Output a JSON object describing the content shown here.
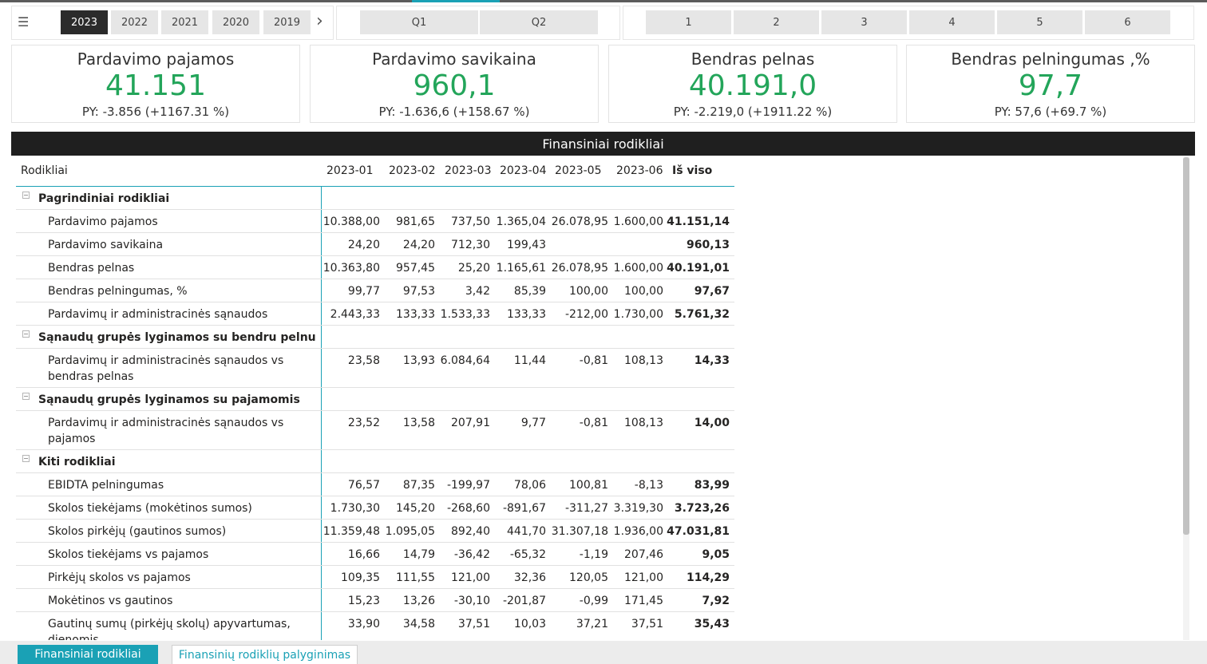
{
  "menu_icon": "hamburger-icon",
  "years": [
    "2023",
    "2022",
    "2021",
    "2020",
    "2019"
  ],
  "selected_year": "2023",
  "quarters": [
    "Q1",
    "Q2"
  ],
  "months": [
    "1",
    "2",
    "3",
    "4",
    "5",
    "6"
  ],
  "cards": [
    {
      "title": "Pardavimo pajamos",
      "value": "41.151",
      "py": "PY: -3.856 (+1167.31 %)"
    },
    {
      "title": "Pardavimo savikaina",
      "value": "960,1",
      "py": "PY: -1.636,6 (+158.67 %)"
    },
    {
      "title": "Bendras pelnas",
      "value": "40.191,0",
      "py": "PY: -2.219,0 (+1911.22 %)"
    },
    {
      "title": "Bendras pelningumas ,%",
      "value": "97,7",
      "py": "PY: 57,6 (+69.7 %)"
    }
  ],
  "table": {
    "title": "Finansiniai rodikliai",
    "headers": [
      "Rodikliai",
      "2023-01",
      "2023-02",
      "2023-03",
      "2023-04",
      "2023-05",
      "2023-06",
      "Iš viso"
    ],
    "rows": [
      {
        "label": "Pagrindiniai rodikliai",
        "group": true
      },
      {
        "label": "Pardavimo pajamos",
        "values": [
          "10.388,00",
          "981,65",
          "737,50",
          "1.365,04",
          "26.078,95",
          "1.600,00",
          "41.151,14"
        ]
      },
      {
        "label": "Pardavimo savikaina",
        "values": [
          "24,20",
          "24,20",
          "712,30",
          "199,43",
          "",
          "",
          "960,13"
        ]
      },
      {
        "label": "Bendras pelnas",
        "values": [
          "10.363,80",
          "957,45",
          "25,20",
          "1.165,61",
          "26.078,95",
          "1.600,00",
          "40.191,01"
        ]
      },
      {
        "label": "Bendras pelningumas, %",
        "values": [
          "99,77",
          "97,53",
          "3,42",
          "85,39",
          "100,00",
          "100,00",
          "97,67"
        ]
      },
      {
        "label": "Pardavimų ir administracinės sąnaudos",
        "values": [
          "2.443,33",
          "133,33",
          "1.533,33",
          "133,33",
          "-212,00",
          "1.730,00",
          "5.761,32"
        ]
      },
      {
        "label": "Sąnaudų grupės lyginamos su bendru pelnu",
        "group": true
      },
      {
        "label": "Pardavimų ir administracinės sąnaudos vs bendras pelnas",
        "values": [
          "23,58",
          "13,93",
          "6.084,64",
          "11,44",
          "-0,81",
          "108,13",
          "14,33"
        ]
      },
      {
        "label": "Sąnaudų grupės lyginamos su pajamomis",
        "group": true
      },
      {
        "label": "Pardavimų ir administracinės sąnaudos vs pajamos",
        "values": [
          "23,52",
          "13,58",
          "207,91",
          "9,77",
          "-0,81",
          "108,13",
          "14,00"
        ]
      },
      {
        "label": "Kiti rodikliai",
        "group": true
      },
      {
        "label": "EBIDTA pelningumas",
        "values": [
          "76,57",
          "87,35",
          "-199,97",
          "78,06",
          "100,81",
          "-8,13",
          "83,99"
        ]
      },
      {
        "label": "Skolos tiekėjams (mokėtinos sumos)",
        "values": [
          "1.730,30",
          "145,20",
          "-268,60",
          "-891,67",
          "-311,27",
          "3.319,30",
          "3.723,26"
        ]
      },
      {
        "label": "Skolos pirkėjų (gautinos sumos)",
        "values": [
          "11.359,48",
          "1.095,05",
          "892,40",
          "441,70",
          "31.307,18",
          "1.936,00",
          "47.031,81"
        ]
      },
      {
        "label": "Skolos tiekėjams vs pajamos",
        "values": [
          "16,66",
          "14,79",
          "-36,42",
          "-65,32",
          "-1,19",
          "207,46",
          "9,05"
        ]
      },
      {
        "label": "Pirkėjų skolos vs pajamos",
        "values": [
          "109,35",
          "111,55",
          "121,00",
          "32,36",
          "120,05",
          "121,00",
          "114,29"
        ]
      },
      {
        "label": "Mokėtinos vs gautinos",
        "values": [
          "15,23",
          "13,26",
          "-30,10",
          "-201,87",
          "-0,99",
          "171,45",
          "7,92"
        ]
      },
      {
        "label": "Gautinų sumų (pirkėjų skolų) apyvartumas, dienomis",
        "values": [
          "33,90",
          "34,58",
          "37,51",
          "10,03",
          "37,21",
          "37,51",
          "35,43"
        ]
      }
    ]
  },
  "tabs": [
    "Finansiniai rodikliai",
    "Finansinių rodiklių palyginimas"
  ],
  "colors": {
    "accent": "#1aa1b5",
    "kpi_green": "#23a55a",
    "header_dark": "#1f1f1f",
    "active_year": "#2b2b2b"
  }
}
